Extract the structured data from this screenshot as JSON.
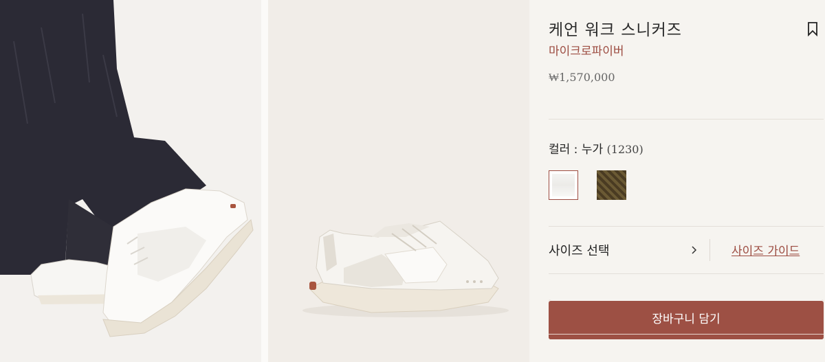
{
  "product": {
    "title": "케언 워크 스니커즈",
    "material": "마이크로파이버",
    "price": "₩1,570,000"
  },
  "color": {
    "label": "컬러 : 누가",
    "code": "(1230)",
    "swatches": [
      {
        "name": "누가",
        "selected": true
      },
      {
        "name": "dark-pattern",
        "selected": false
      }
    ]
  },
  "size": {
    "select_label": "사이즈 선택",
    "guide_label": "사이즈 가이드"
  },
  "cart": {
    "button_label": "장바구니 담기"
  },
  "icons": {
    "bookmark": "bookmark-icon",
    "chevron": "chevron-right-icon"
  },
  "colors": {
    "accent": "#9d5044",
    "background": "#f6f4f0"
  }
}
